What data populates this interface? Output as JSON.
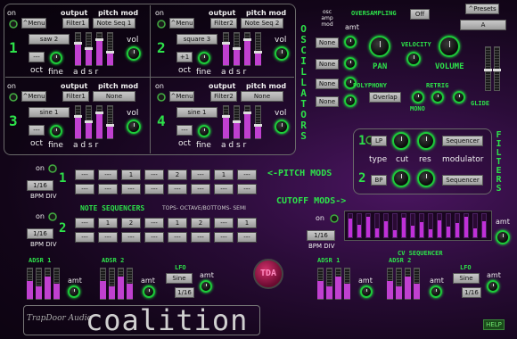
{
  "osc_common": {
    "on": "on",
    "output": "output",
    "pitch_mod": "pitch mod",
    "oct": "oct",
    "fine": "fine",
    "adsr": "a d s r",
    "vol": "vol",
    "menu": "^Menu"
  },
  "osc1": {
    "num": "1",
    "filter": "Filter1",
    "pitchmod": "Note Seq 1",
    "wave": "saw 2",
    "oct": "---"
  },
  "osc2": {
    "num": "2",
    "filter": "Filter2",
    "pitchmod": "Note Seq 2",
    "wave": "square 3",
    "oct": "+1"
  },
  "osc3": {
    "num": "3",
    "filter": "Filter1",
    "pitchmod": "None",
    "wave": "sine 1",
    "oct": "---"
  },
  "osc4": {
    "num": "4",
    "filter": "Filter2",
    "pitchmod": "None",
    "wave": "sine 1",
    "oct": "---"
  },
  "oscillators_title": "OSCILLATORS",
  "osc_amp_mod": {
    "header": "osc amp mod",
    "amt": "amt",
    "values": [
      "None",
      "None",
      "None",
      "None"
    ]
  },
  "oversampling": {
    "label": "OVERSAMPLING",
    "value": "Off"
  },
  "presets": {
    "button": "^Presets",
    "value": "A"
  },
  "pan_label": "PAN",
  "velocity_label": "VELOCITY",
  "volume_label": "VOLUME",
  "polyphony": {
    "label": "POLYPHONY",
    "value": "Overlap"
  },
  "retrig_label": "RETRIG",
  "mono_label": "MONO",
  "glide_label": "GLIDE",
  "filters": {
    "title": "FILTERS",
    "f1": {
      "num": "1",
      "type": "LP",
      "mod": "Sequencer"
    },
    "f2": {
      "num": "2",
      "type": "BP",
      "mod": "Sequencer"
    },
    "type_lbl": "type",
    "cut_lbl": "cut",
    "res_lbl": "res",
    "mod_lbl": "modulator"
  },
  "note_seq": {
    "on": "on",
    "bpm_div_value": "1/16",
    "bpm_div_label": "BPM DIV",
    "row1_num": "1",
    "row2_num": "2",
    "row1": [
      "---",
      "---",
      "1",
      "---",
      "2",
      "---",
      "1",
      "---"
    ],
    "row2": [
      "---",
      "1",
      "2",
      "---",
      "1",
      "2",
      "---",
      "1"
    ],
    "title": "NOTE SEQUENCERS",
    "subtitle": "TOPS- OCTAVE/BOTTOMS- SEMI"
  },
  "pitch_mods_label": "<-PITCH MODS",
  "cutoff_mods_label": "CUTOFF MODS->",
  "cv_seq": {
    "on": "on",
    "bpm_div_value": "1/16",
    "bpm_div_label": "BPM DIV",
    "amt": "amt",
    "title": "CV SEQUENCER",
    "levels": [
      0.8,
      0.55,
      0.9,
      0.4,
      0.7,
      0.3,
      0.85,
      0.5,
      0.65,
      0.35,
      0.75,
      0.45,
      0.6,
      0.9,
      0.4,
      0.7
    ]
  },
  "left_mod": {
    "adsr1": "ADSR 1",
    "adsr2": "ADSR 2",
    "lfo": "LFO",
    "lfo_wave": "Sine",
    "lfo_rate": "1/16",
    "amt": "amt"
  },
  "right_mod": {
    "adsr1": "ADSR 1",
    "adsr2": "ADSR 2",
    "lfo": "LFO",
    "lfo_wave": "Sine",
    "lfo_rate": "1/16",
    "amt": "amt"
  },
  "logo_badge": "TDA",
  "brand": {
    "maker": "TrapDoor Audio",
    "product": "coalition"
  },
  "help": "HELP"
}
